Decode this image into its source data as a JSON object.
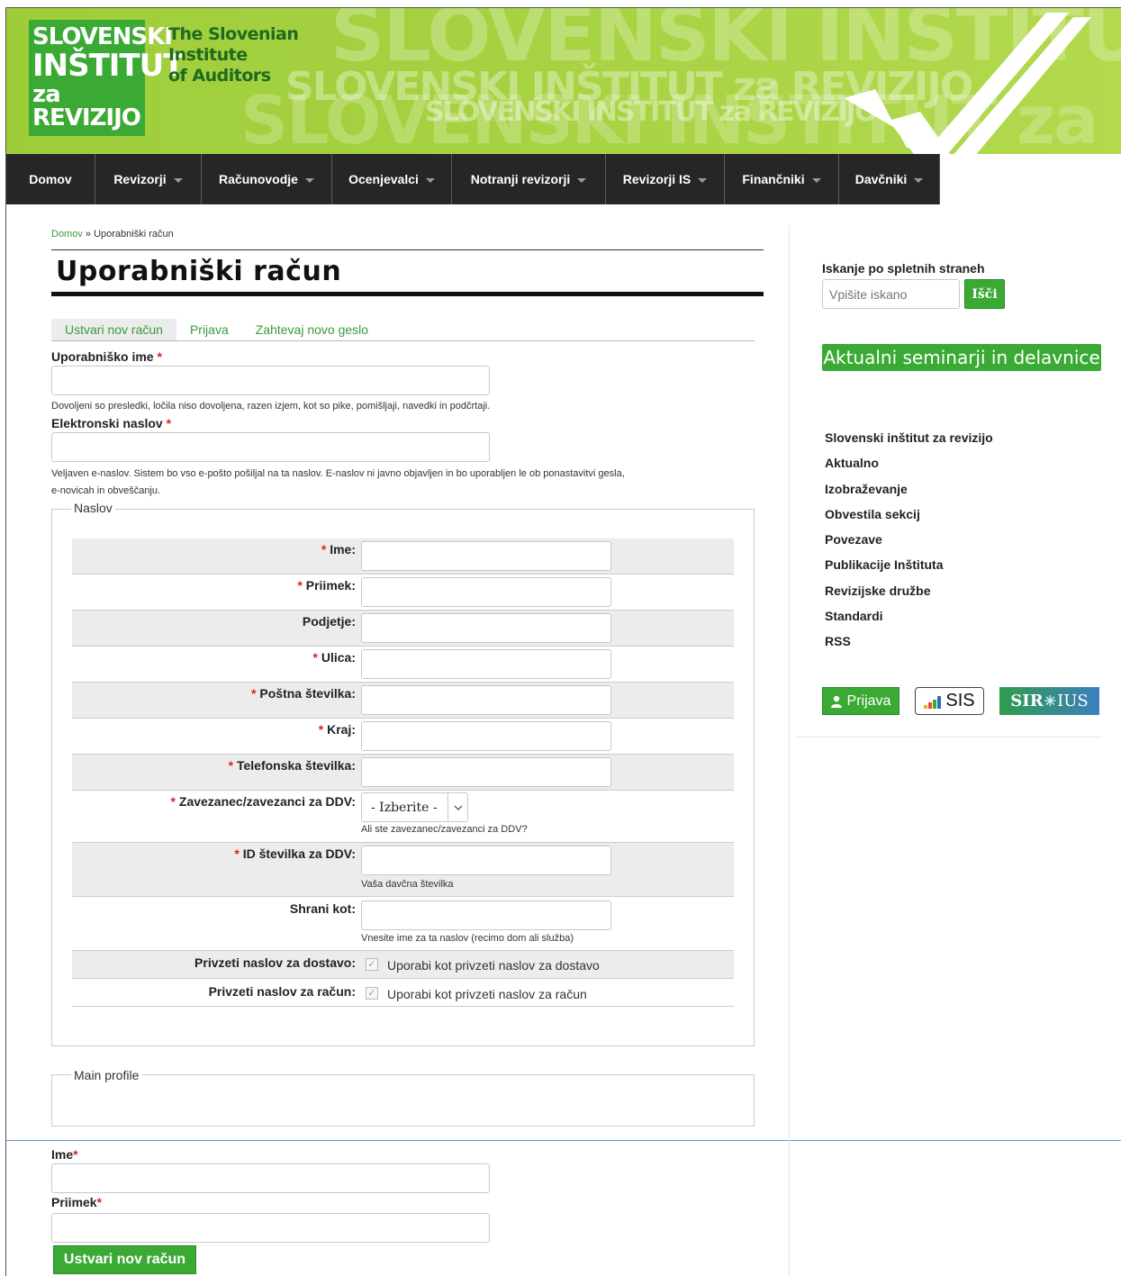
{
  "header": {
    "logo_lines": [
      "SLOVENSKI",
      "INŠTITUT",
      "za REVIZIJO"
    ],
    "logo_en_lines": [
      "The Slovenian",
      "Institute",
      "of Auditors"
    ]
  },
  "nav": {
    "items": [
      {
        "label": "Domov",
        "dropdown": false
      },
      {
        "label": "Revizorji",
        "dropdown": true
      },
      {
        "label": "Računovodje",
        "dropdown": true
      },
      {
        "label": "Ocenjevalci",
        "dropdown": true
      },
      {
        "label": "Notranji revizorji",
        "dropdown": true
      },
      {
        "label": "Revizorji IS",
        "dropdown": true
      },
      {
        "label": "Finančniki",
        "dropdown": true
      },
      {
        "label": "Davčniki",
        "dropdown": true
      }
    ]
  },
  "breadcrumb": {
    "home": "Domov",
    "separator": " » ",
    "current": "Uporabniški račun"
  },
  "page_title": "Uporabniški račun",
  "tabs": [
    {
      "label": "Ustvari nov račun",
      "active": true
    },
    {
      "label": "Prijava",
      "active": false
    },
    {
      "label": "Zahtevaj novo geslo",
      "active": false
    }
  ],
  "form": {
    "username_label": "Uporabniško ime",
    "username_value": "",
    "username_desc": "Dovoljeni so presledki, ločila niso dovoljena, razen izjem, kot so pike, pomišljaji, navedki in podčrtaji.",
    "email_label": "Elektronski naslov",
    "email_value": "",
    "email_desc_1": "Veljaven e-naslov. Sistem bo vso e-pošto pošiljal na ta naslov. E-naslov ni javno objavljen in bo uporabljen le ob ponastavitvi gesla,",
    "email_desc_2": "e-novicah in obveščanju.",
    "required_mark": "*"
  },
  "address": {
    "legend": "Naslov",
    "fields": {
      "ime": "Ime:",
      "priimek": "Priimek:",
      "podjetje": "Podjetje:",
      "ulica": "Ulica:",
      "postna": "Poštna številka:",
      "kraj": "Kraj:",
      "telefon": "Telefonska številka:",
      "ddv_zavezanec": "Zavezanec/zavezanci za DDV:",
      "ddv_id": "ID številka za DDV:",
      "shrani": "Shrani kot:",
      "dostava": "Privzeti naslov za dostavo:",
      "racun": "Privzeti naslov za račun:"
    },
    "ddv_select": "- Izberite -",
    "ddv_desc": "Ali ste zavezanec/zavezanci za DDV?",
    "ddv_id_desc": "Vaša davčna številka",
    "shrani_desc": "Vnesite ime za ta naslov (recimo dom ali služba)",
    "dostava_cb_label": "Uporabi kot privzeti naslov za dostavo",
    "racun_cb_label": "Uporabi kot privzeti naslov za račun"
  },
  "main_profile": {
    "legend": "Main profile"
  },
  "profile": {
    "ime_label": "Ime",
    "priimek_label": "Priimek"
  },
  "submit_label": "Ustvari nov račun",
  "sidebar": {
    "search_label": "Iskanje po spletnih straneh",
    "search_placeholder": "Vpišite iskano",
    "search_button": "Išči",
    "seminar_button": "Aktualni seminarji in delavnice",
    "menu": [
      "Slovenski inštitut za revizijo",
      "Aktualno",
      "Izobraževanje",
      "Obvestila sekcij",
      "Povezave",
      "Publikacije Inštituta",
      "Revizijske družbe",
      "Standardi",
      "RSS"
    ],
    "prijava_button": "Prijava",
    "sis_label": "SIS",
    "sir_label": "SIR",
    "ius_label": "IUS"
  },
  "colors": {
    "accent_green": "#3aaa35",
    "nav_dark": "#262626",
    "header_green": "#a9d445"
  }
}
